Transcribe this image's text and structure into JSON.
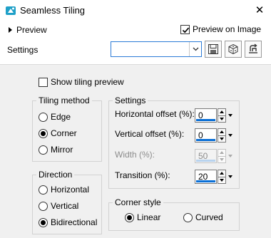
{
  "window": {
    "title": "Seamless Tiling",
    "app_icon": "paint-app-icon",
    "close_glyph": "✕"
  },
  "preview": {
    "label": "Preview",
    "preview_on_image_label": "Preview on Image",
    "preview_on_image_checked": true
  },
  "settings_bar": {
    "label": "Settings",
    "preset_value": ""
  },
  "show_tiling_preview": {
    "label": "Show tiling preview",
    "checked": false
  },
  "tiling_method": {
    "title": "Tiling method",
    "options": [
      {
        "label": "Edge",
        "selected": false
      },
      {
        "label": "Corner",
        "selected": true
      },
      {
        "label": "Mirror",
        "selected": false
      }
    ]
  },
  "direction": {
    "title": "Direction",
    "options": [
      {
        "label": "Horizontal",
        "selected": false
      },
      {
        "label": "Vertical",
        "selected": false
      },
      {
        "label": "Bidirectional",
        "selected": true
      }
    ]
  },
  "settings_group": {
    "title": "Settings",
    "fields": [
      {
        "label": "Horizontal offset (%):",
        "value": "0",
        "enabled": true
      },
      {
        "label": "Vertical offset (%):",
        "value": "0",
        "enabled": true
      },
      {
        "label": "Width (%):",
        "value": "50",
        "enabled": false
      },
      {
        "label": "Transition (%):",
        "value": "20",
        "enabled": true
      }
    ]
  },
  "corner_style": {
    "title": "Corner style",
    "options": [
      {
        "label": "Linear",
        "selected": true
      },
      {
        "label": "Curved",
        "selected": false
      }
    ]
  },
  "colors": {
    "accent": "#0a6fd6",
    "panel_bg": "#f0f0f0",
    "icon_teal": "#1fa0c8"
  }
}
